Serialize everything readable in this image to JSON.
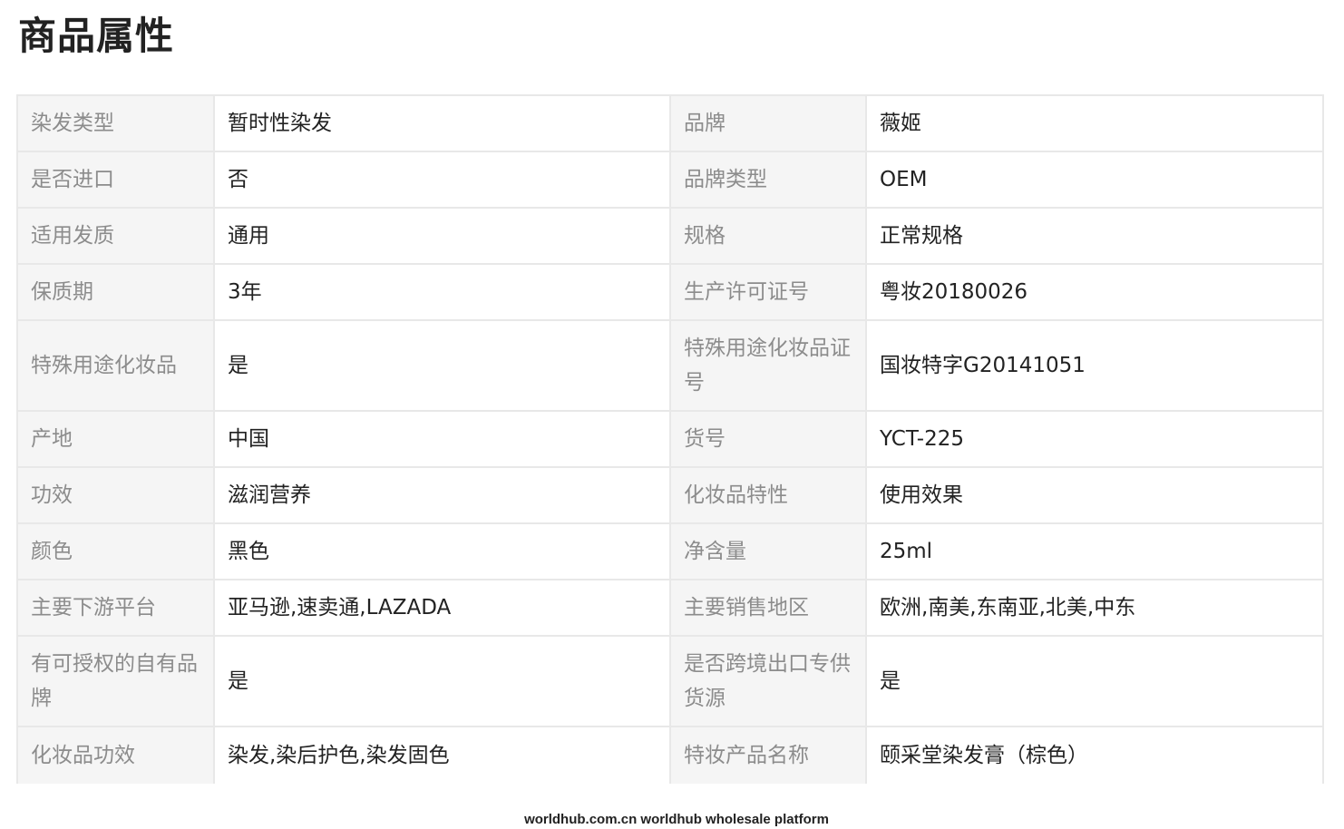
{
  "title": "商品属性",
  "rows": [
    {
      "k1": "染发类型",
      "v1": "暂时性染发",
      "k2": "品牌",
      "v2": "薇姬"
    },
    {
      "k1": "是否进口",
      "v1": "否",
      "k2": "品牌类型",
      "v2": "OEM"
    },
    {
      "k1": "适用发质",
      "v1": "通用",
      "k2": "规格",
      "v2": "正常规格"
    },
    {
      "k1": "保质期",
      "v1": "3年",
      "k2": "生产许可证号",
      "v2": "粤妆20180026"
    },
    {
      "k1": "特殊用途化妆品",
      "v1": "是",
      "k2": "特殊用途化妆品证号",
      "v2": "国妆特字G20141051"
    },
    {
      "k1": "产地",
      "v1": "中国",
      "k2": "货号",
      "v2": "YCT-225"
    },
    {
      "k1": "功效",
      "v1": "滋润营养",
      "k2": "化妆品特性",
      "v2": "使用效果"
    },
    {
      "k1": "颜色",
      "v1": "黑色",
      "k2": "净含量",
      "v2": "25ml"
    },
    {
      "k1": "主要下游平台",
      "v1": "亚马逊,速卖通,LAZADA",
      "k2": "主要销售地区",
      "v2": "欧洲,南美,东南亚,北美,中东"
    },
    {
      "k1": "有可授权的自有品牌",
      "v1": "是",
      "k2": "是否跨境出口专供货源",
      "v2": "是"
    },
    {
      "k1": "化妆品功效",
      "v1": "染发,染后护色,染发固色",
      "k2": "特妆产品名称",
      "v2": "颐采堂染发膏（棕色）"
    }
  ],
  "footer": "worldhub.com.cn worldhub wholesale platform"
}
